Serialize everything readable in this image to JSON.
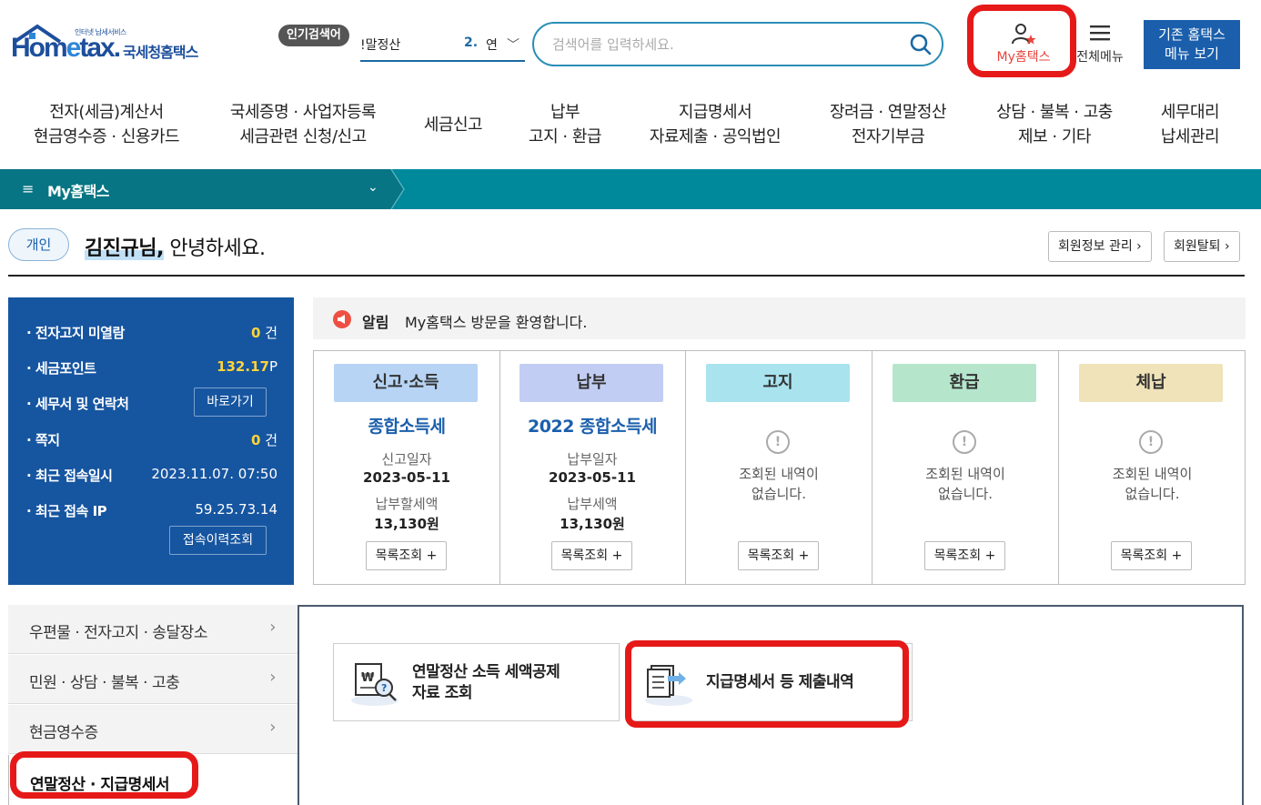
{
  "header": {
    "logo_small": "인터넷 납세서비스",
    "logo_main_pre": "Hom",
    "logo_main_e": "e",
    "logo_main_post": "tax.",
    "logo_korean": "국세청홈택스",
    "popular_badge": "인기검색어",
    "popular_keyword": "!말정산",
    "popular_rank": "2.",
    "popular_rank_text": "연",
    "search_placeholder": "검색어를 입력하세요.",
    "my_hometax_label": "My홈택스",
    "all_menu_label": "전체메뉴",
    "old_menu_line1": "기존 홈택스",
    "old_menu_line2": "메뉴 보기"
  },
  "gnb": [
    {
      "line1": "전자(세금)계산서",
      "line2": "현금영수증 · 신용카드"
    },
    {
      "line1": "국세증명 · 사업자등록",
      "line2": "세금관련 신청/신고"
    },
    {
      "line1": "세금신고",
      "line2": ""
    },
    {
      "line1": "납부",
      "line2": "고지 · 환급"
    },
    {
      "line1": "지급명세서",
      "line2": "자료제출 · 공익법인"
    },
    {
      "line1": "장려금 · 연말정산",
      "line2": "전자기부금"
    },
    {
      "line1": "상담 · 불복 · 고충",
      "line2": "제보 · 기타"
    },
    {
      "line1": "세무대리",
      "line2": "납세관리"
    }
  ],
  "teal_bar": {
    "title": "My홈택스"
  },
  "greeting": {
    "badge": "개인",
    "name": "김진규님,",
    "text": " 안녕하세요.",
    "member_info_btn": "회원정보 관리 ›",
    "withdraw_btn": "회원탈퇴 ›"
  },
  "info": {
    "unread_label": "· 전자고지 미열람",
    "unread_value": "0",
    "unread_unit": "건",
    "points_label": "· 세금포인트",
    "points_value": "132.17",
    "points_unit": "P",
    "tax_office_label": "· 세무서 및 연락처",
    "tax_office_btn": "바로가기",
    "memo_label": "· 쪽지",
    "memo_value": "0",
    "memo_unit": "건",
    "last_login_label": "· 최근 접속일시",
    "last_login_value": "2023.11.07.  07:50",
    "last_ip_label": "· 최근 접속 IP",
    "last_ip_value": "59.25.73.14",
    "history_btn": "접속이력조회"
  },
  "notice": {
    "label": "알림",
    "text": "My홈택스 방문을 환영합니다."
  },
  "status_cells": [
    {
      "tag": "신고·소득",
      "color": "#b7d4f5",
      "name": "종합소득세",
      "label1": "신고일자",
      "value1": "2023-05-11",
      "label2": "납부할세액",
      "value2": "13,130원",
      "button": "목록조회 +"
    },
    {
      "tag": "납부",
      "color": "#c2cdf3",
      "name": "2022 종합소득세",
      "label1": "납부일자",
      "value1": "2023-05-11",
      "label2": "납부세액",
      "value2": "13,130원",
      "button": "목록조회 +"
    },
    {
      "tag": "고지",
      "color": "#a8e3ee",
      "empty_line1": "조회된 내역이",
      "empty_line2": "없습니다.",
      "button": "목록조회 +"
    },
    {
      "tag": "환급",
      "color": "#b5e6cc",
      "empty_line1": "조회된 내역이",
      "empty_line2": "없습니다.",
      "button": "목록조회 +"
    },
    {
      "tag": "체납",
      "color": "#f0e3b9",
      "empty_line1": "조회된 내역이",
      "empty_line2": "없습니다.",
      "button": "목록조회 +"
    }
  ],
  "side_menu": {
    "items": [
      "우편물 · 전자고지 · 송달장소",
      "민원 · 상담 · 불복 · 고충",
      "현금영수증"
    ],
    "active": "연말정산 · 지급명세서"
  },
  "cards": [
    {
      "line1": "연말정산 소득 세액공제",
      "line2": "자료 조회"
    },
    {
      "line1": "지급명세서 등 제출내역",
      "line2": ""
    }
  ],
  "colors": {
    "primary": "#1655a0",
    "teal": "#00899b",
    "annotation": "#e61919",
    "accent_red": "#e7443c"
  }
}
